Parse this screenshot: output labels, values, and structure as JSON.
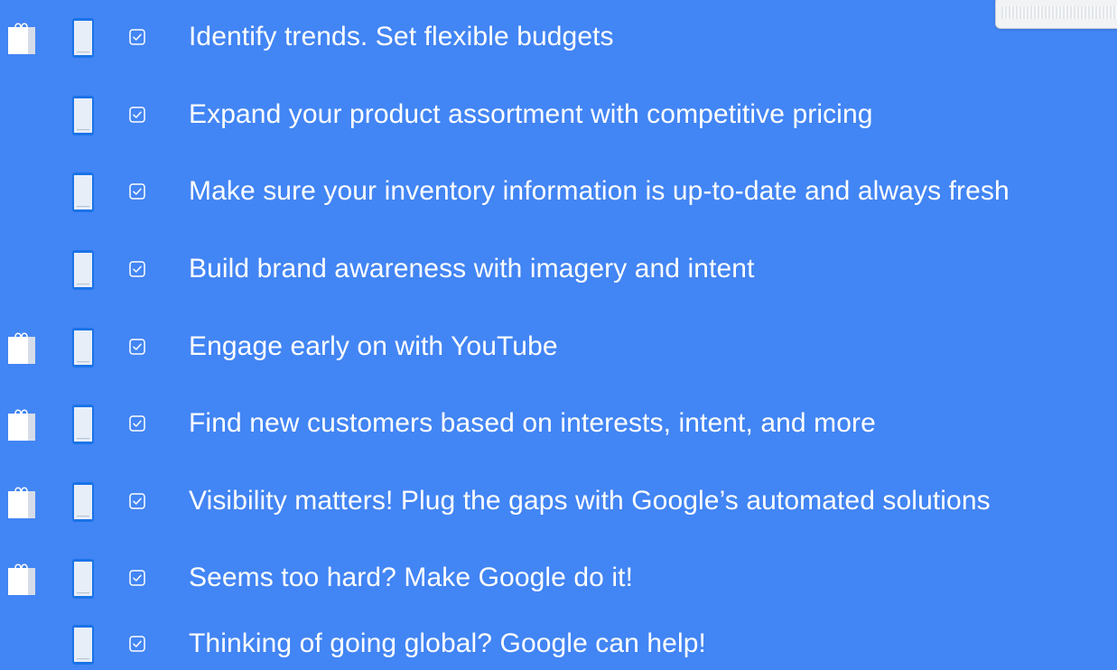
{
  "page": {
    "background_color": "#4285f4",
    "text_color": "#ffffff"
  },
  "icons": {
    "bag": "shopping-bag-icon",
    "phone": "smartphone-icon",
    "check": "checkbox-checked-icon"
  },
  "checklist": {
    "items": [
      {
        "label": "Identify trends. Set flexible budgets",
        "has_bag_icon": true
      },
      {
        "label": "Expand your product assortment with competitive pricing",
        "has_bag_icon": false
      },
      {
        "label": "Make sure your inventory information is up-to-date and always fresh",
        "has_bag_icon": false
      },
      {
        "label": "Build brand awareness with imagery and intent",
        "has_bag_icon": false
      },
      {
        "label": "Engage early on with YouTube",
        "has_bag_icon": true
      },
      {
        "label": "Find new customers based on interests, intent, and more",
        "has_bag_icon": true
      },
      {
        "label": "Visibility matters! Plug the gaps with Google’s automated solutions",
        "has_bag_icon": true
      },
      {
        "label": "Seems too hard? Make Google do it!",
        "has_bag_icon": true
      },
      {
        "label": "Thinking of going global? Google can help!",
        "has_bag_icon": false
      }
    ]
  }
}
